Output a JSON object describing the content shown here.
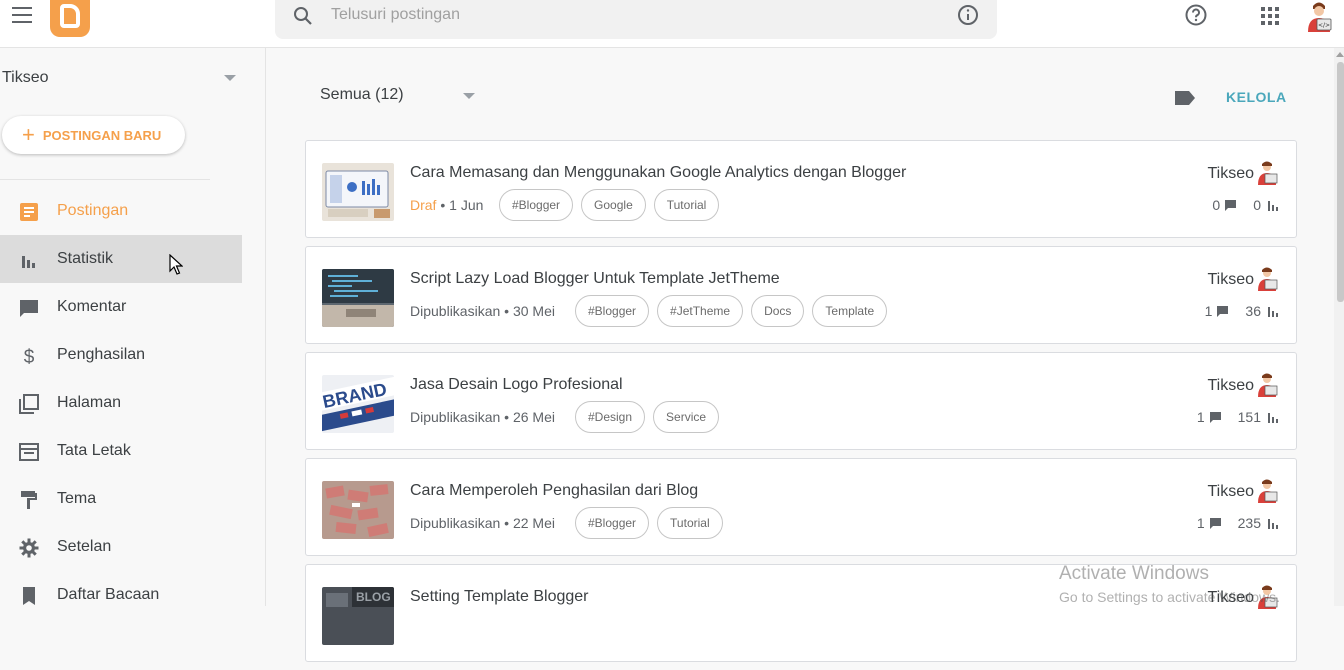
{
  "topbar": {
    "search_placeholder": "Telusuri postingan"
  },
  "sidebar": {
    "blog_name": "Tikseo",
    "new_post_label": "POSTINGAN BARU",
    "items": [
      {
        "label": "Postingan",
        "icon": "posts-icon"
      },
      {
        "label": "Statistik",
        "icon": "stats-icon"
      },
      {
        "label": "Komentar",
        "icon": "comment-icon"
      },
      {
        "label": "Penghasilan",
        "icon": "dollar-icon"
      },
      {
        "label": "Halaman",
        "icon": "pages-icon"
      },
      {
        "label": "Tata Letak",
        "icon": "layout-icon"
      },
      {
        "label": "Tema",
        "icon": "paint-roller-icon"
      },
      {
        "label": "Setelan",
        "icon": "gear-icon"
      },
      {
        "label": "Daftar Bacaan",
        "icon": "bookmark-icon"
      }
    ]
  },
  "main": {
    "filter_label": "Semua (12)",
    "manage_label": "KELOLA",
    "posts": [
      {
        "title": "Cara Memasang dan Menggunakan Google Analytics dengan Blogger",
        "status": "Draf",
        "date": "1 Jun",
        "tags": [
          "#Blogger",
          "Google",
          "Tutorial"
        ],
        "author": "Tikseo",
        "comments": "0",
        "views": "0"
      },
      {
        "title": "Script Lazy Load Blogger Untuk Template JetTheme",
        "status": "Dipublikasikan",
        "date": "30 Mei",
        "tags": [
          "#Blogger",
          "#JetTheme",
          "Docs",
          "Template"
        ],
        "author": "Tikseo",
        "comments": "1",
        "views": "36"
      },
      {
        "title": "Jasa Desain Logo Profesional",
        "status": "Dipublikasikan",
        "date": "26 Mei",
        "tags": [
          "#Design",
          "Service"
        ],
        "author": "Tikseo",
        "comments": "1",
        "views": "151"
      },
      {
        "title": "Cara Memperoleh Penghasilan dari Blog",
        "status": "Dipublikasikan",
        "date": "22 Mei",
        "tags": [
          "#Blogger",
          "Tutorial"
        ],
        "author": "Tikseo",
        "comments": "1",
        "views": "235"
      },
      {
        "title": "Setting Template Blogger",
        "author": "Tikseo"
      }
    ]
  },
  "watermark": {
    "line1": "Activate Windows",
    "line2": "Go to Settings to activate Windows."
  },
  "colors": {
    "accent": "#f5a04b",
    "link": "#4aa7bb",
    "hover": "#dcdcdc"
  }
}
